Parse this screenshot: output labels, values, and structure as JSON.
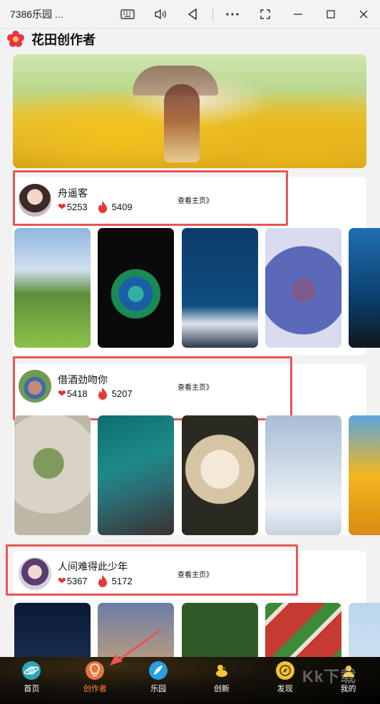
{
  "window": {
    "title": "7386乐园 ...",
    "icons": [
      "keyboard-icon",
      "volume-icon",
      "back-triangle-icon",
      "more-icon",
      "screenshot-icon",
      "minimize-icon",
      "maximize-icon",
      "close-icon"
    ]
  },
  "header": {
    "app_name": "花田创作者"
  },
  "creators": [
    {
      "name": "舟遥客",
      "likes": "5253",
      "hot": "5409",
      "link": "查看主页》"
    },
    {
      "name": "借酒劲吻你",
      "likes": "5418",
      "hot": "5207",
      "link": "查看主页》"
    },
    {
      "name": "人间难得此少年",
      "likes": "5367",
      "hot": "5172",
      "link": "查看主页》"
    }
  ],
  "nav": {
    "items": [
      {
        "label": "首页",
        "icon": "planet-icon"
      },
      {
        "label": "创作者",
        "icon": "lightbulb-icon"
      },
      {
        "label": "乐园",
        "icon": "feather-icon"
      },
      {
        "label": "创新",
        "icon": "duck-icon"
      },
      {
        "label": "发现",
        "icon": "compass-icon"
      },
      {
        "label": "我的",
        "icon": "profile-icon"
      }
    ],
    "active": "创作者"
  },
  "watermark": "Kk下载",
  "colors": {
    "highlight": "#e85656",
    "active_nav": "#ff8a3d",
    "heart": "#e03232"
  }
}
